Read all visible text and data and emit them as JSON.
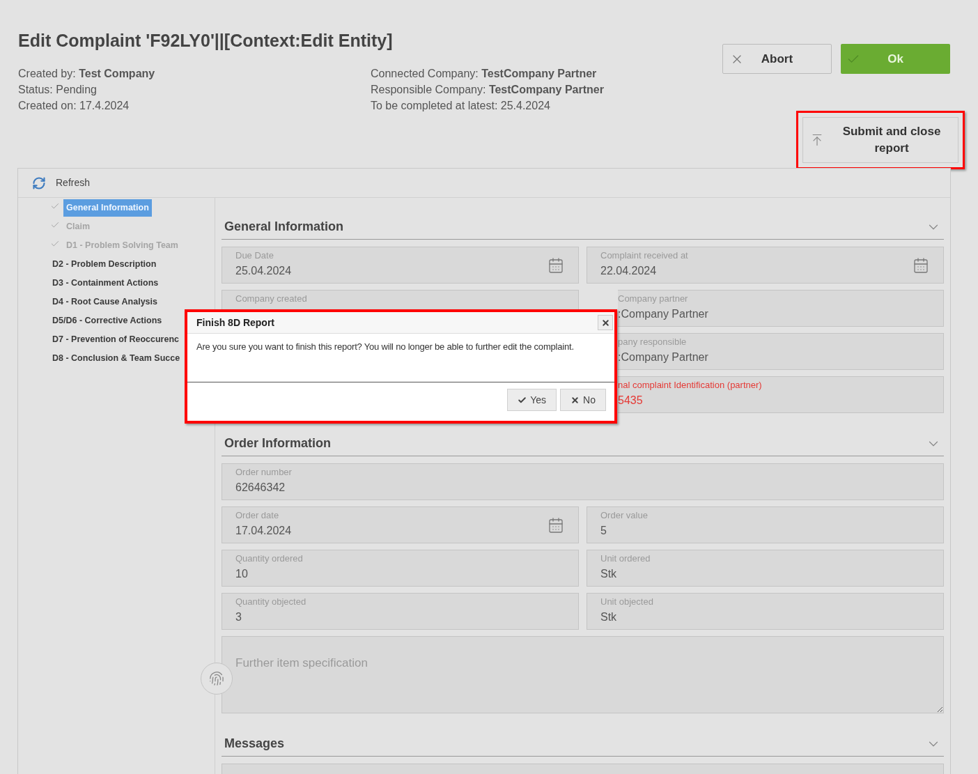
{
  "title": "Edit Complaint 'F92LY0'||[Context:Edit Entity]",
  "info_left": [
    "Created by: **Test Company**",
    "Status: Pending",
    "Created on: 17.4.2024"
  ],
  "info_right": [
    "Connected Company: **TestCompany Partner**",
    "Responsible Company: **TestCompany Partner**",
    "To be completed at latest: 25.4.2024"
  ],
  "buttons": [
    {
      "kind": "abort",
      "label": "Abort"
    },
    {
      "kind": "ok",
      "label": "Ok"
    }
  ],
  "submit_button": {
    "label": "Submit and close report",
    "highlighted": true
  },
  "toolbar": {
    "refresh": "Refresh"
  },
  "nav": [
    {
      "label": "General Information",
      "checked": true,
      "selected": true,
      "disabled": false
    },
    {
      "label": "Claim",
      "checked": true,
      "selected": false,
      "disabled": true
    },
    {
      "label": "D1 - Problem Solving Team",
      "checked": true,
      "selected": false,
      "disabled": true
    },
    {
      "label": "D2 - Problem Description",
      "checked": false,
      "selected": false,
      "disabled": false
    },
    {
      "label": "D3 - Containment Actions",
      "checked": false,
      "selected": false,
      "disabled": false
    },
    {
      "label": "D4 - Root Cause Analysis",
      "checked": false,
      "selected": false,
      "disabled": false
    },
    {
      "label": "D5/D6 - Corrective Actions",
      "checked": false,
      "selected": false,
      "disabled": false
    },
    {
      "label": "D7 - Prevention of Reoccurenc",
      "checked": false,
      "selected": false,
      "disabled": false
    },
    {
      "label": "D8 - Conclusion & Team Succe",
      "checked": false,
      "selected": false,
      "disabled": false
    }
  ],
  "sections": [
    {
      "title": "General Information",
      "expanded": true,
      "rows": [
        [
          {
            "kind": "date",
            "label": "Due Date",
            "value": "25.04.2024",
            "error": false,
            "partly_hidden": false
          },
          {
            "kind": "date",
            "label": "Complaint received at",
            "value": "22.04.2024",
            "error": false,
            "partly_hidden": false
          }
        ],
        [
          {
            "kind": "text",
            "label": "Company created",
            "error": false,
            "partly_hidden": false
          },
          {
            "kind": "text",
            "label": "Company partner",
            "value": ":Company Partner",
            "error": false,
            "partly_hidden": true
          }
        ],
        [
          {
            "kind": "spacer"
          },
          {
            "kind": "text",
            "label": "pany responsible",
            "value": ":Company Partner",
            "error": false,
            "partly_hidden": true
          }
        ],
        [
          {
            "kind": "spacer"
          },
          {
            "kind": "text",
            "label": "nal complaint Identification (partner)",
            "value": "5435",
            "error": true,
            "partly_hidden": true
          }
        ]
      ]
    },
    {
      "title": "Order Information",
      "expanded": true,
      "rows": [
        [
          {
            "kind": "text",
            "label": "Order number",
            "value": "62646342",
            "error": false,
            "partly_hidden": false
          }
        ],
        [
          {
            "kind": "date",
            "label": "Order date",
            "value": "17.04.2024",
            "error": false,
            "partly_hidden": false
          },
          {
            "kind": "text",
            "label": "Order value",
            "value": "5",
            "error": false,
            "partly_hidden": false
          }
        ],
        [
          {
            "kind": "text",
            "label": "Quantity ordered",
            "value": "10",
            "error": false,
            "partly_hidden": false
          },
          {
            "kind": "text",
            "label": "Unit ordered",
            "value": "Stk",
            "error": false,
            "partly_hidden": false
          }
        ],
        [
          {
            "kind": "text",
            "label": "Quantity objected",
            "value": "3",
            "error": false,
            "partly_hidden": false
          },
          {
            "kind": "text",
            "label": "Unit objected",
            "value": "Stk",
            "error": false,
            "partly_hidden": false
          }
        ],
        [
          {
            "kind": "textarea",
            "placeholder": "Further item specification"
          }
        ]
      ]
    },
    {
      "title": "Messages",
      "expanded": true,
      "rows": [
        [
          {
            "kind": "stub"
          }
        ]
      ]
    }
  ],
  "dialog": {
    "title": "Finish 8D Report",
    "message": "Are you sure you want to finish this report? You will no longer be able to further edit the complaint.",
    "highlighted": true,
    "buttons": [
      {
        "kind": "yes",
        "label": "Yes"
      },
      {
        "kind": "no",
        "label": "No"
      }
    ]
  }
}
